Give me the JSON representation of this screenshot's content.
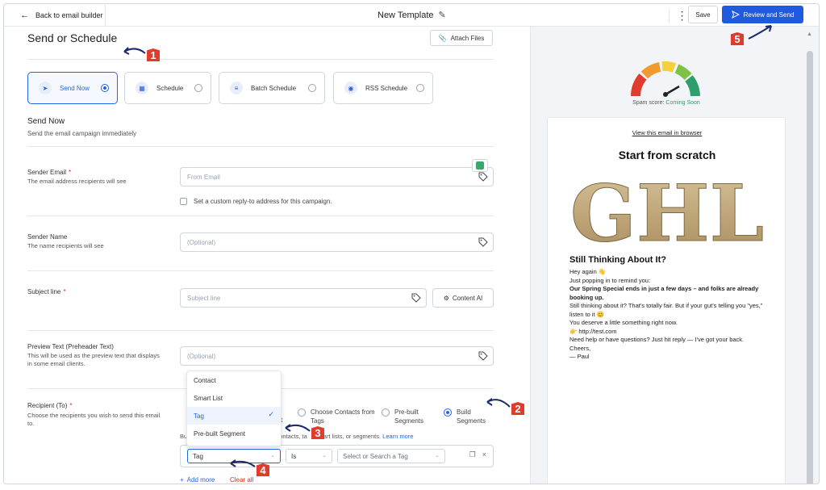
{
  "topbar": {
    "back_label": "Back to email builder",
    "template_title": "New Template",
    "save_label": "Save",
    "review_label": "Review and Send"
  },
  "left": {
    "heading": "Send or Schedule",
    "attach_label": "Attach Files",
    "options": [
      {
        "label": "Send Now",
        "icon": "send-icon",
        "selected": true
      },
      {
        "label": "Schedule",
        "icon": "calendar-icon",
        "selected": false
      },
      {
        "label": "Batch Schedule",
        "icon": "batch-icon",
        "selected": false
      },
      {
        "label": "RSS Schedule",
        "icon": "rss-icon",
        "selected": false
      }
    ],
    "section_title": "Send Now",
    "section_sub": "Send the email campaign immediately",
    "sender_email": {
      "label": "Sender Email",
      "help": "The email address recipients will see",
      "placeholder": "From Email"
    },
    "custom_reply": "Set a custom reply-to address for this campaign.",
    "sender_name": {
      "label": "Sender Name",
      "help": "The name recipients will see",
      "placeholder": "(Optional)"
    },
    "subject": {
      "label": "Subject line",
      "placeholder": "Subject line",
      "content_ai": "Content AI"
    },
    "preview_text": {
      "label": "Preview Text (Preheader Text)",
      "help": "This will be used as the preview text that displays in some email clients.",
      "placeholder": "(Optional)"
    },
    "recipient": {
      "label": "Recipient (To)",
      "help": "Choose the recipients you wish to send this email to.",
      "radio_partial": "t",
      "radios": [
        {
          "label": "Choose Contacts from Tags",
          "selected": false
        },
        {
          "label": "Pre-built Segments",
          "selected": false
        },
        {
          "label": "Build Segments",
          "selected": true
        }
      ],
      "helper_prefix": "Bu",
      "helper_text": "ontacts, ta",
      "helper_tail": "art lists, or segments.",
      "learn_more": "Learn more",
      "seg_field": "Tag",
      "seg_op": "Is",
      "seg_value_placeholder": "Select or Search a Tag",
      "add_more": "Add more",
      "clear_all": "Clear all"
    },
    "dropdown": [
      {
        "label": "Contact",
        "selected": false
      },
      {
        "label": "Smart List",
        "selected": false
      },
      {
        "label": "Tag",
        "selected": true
      },
      {
        "label": "Pre-built Segment",
        "selected": false
      }
    ]
  },
  "right": {
    "spam_prefix": "Spam score:",
    "spam_value": "Coming Soon",
    "view_link": "View this email in browser",
    "title": "Start from scratch",
    "logo_text": "GHL",
    "h2": "Still Thinking About It?",
    "lines": [
      "Hey again 👋",
      "Just popping in to remind you:",
      "Our Spring Special ends in just a few days – and folks are already booking up.",
      "Still thinking about it? That's totally fair. But if your gut's telling you \"yes,\" listen to it 😊",
      "You deserve a little something right now.",
      "👉 http://test.com",
      "Need help or have questions? Just hit reply — I've got your back.",
      "Cheers,",
      "— Paul"
    ]
  },
  "annotations": [
    "1",
    "2",
    "3",
    "4",
    "5"
  ],
  "colors": {
    "accent": "#1f5ae0",
    "annotation": "#e03b2d",
    "gauge": [
      "#e03b2d",
      "#f29a2e",
      "#f3d13a",
      "#7cc245",
      "#2e9e6a"
    ]
  }
}
